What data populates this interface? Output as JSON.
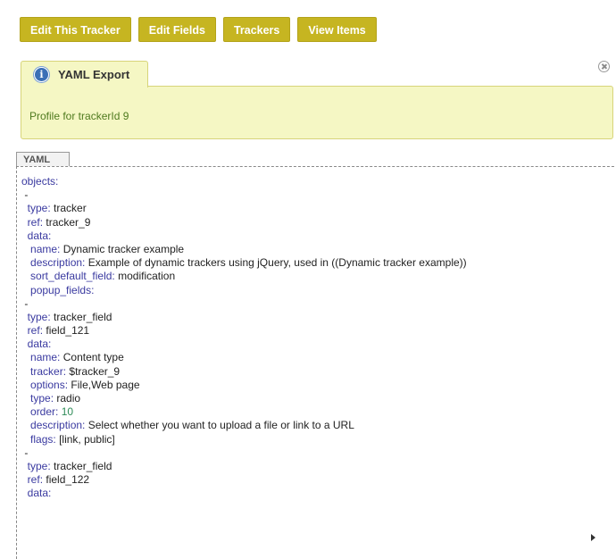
{
  "toolbar": {
    "buttons": [
      "Edit This Tracker",
      "Edit Fields",
      "Trackers",
      "View Items"
    ]
  },
  "panel": {
    "tab_label": "YAML Export",
    "message": "Profile for trackerId 9"
  },
  "yaml_tab_label": "YAML",
  "yaml": {
    "lines": [
      {
        "indent": "",
        "key": "objects",
        "value": ""
      },
      {
        "indent": " ",
        "key": "",
        "value": "-"
      },
      {
        "indent": "  ",
        "key": "type",
        "value": "tracker"
      },
      {
        "indent": "  ",
        "key": "ref",
        "value": "tracker_9"
      },
      {
        "indent": "  ",
        "key": "data",
        "value": ""
      },
      {
        "indent": "   ",
        "key": "name",
        "value": "Dynamic tracker example"
      },
      {
        "indent": "   ",
        "key": "description",
        "value": "Example of dynamic trackers using jQuery, used in ((Dynamic tracker example))"
      },
      {
        "indent": "   ",
        "key": "sort_default_field",
        "value": "modification"
      },
      {
        "indent": "   ",
        "key": "popup_fields",
        "value": ""
      },
      {
        "indent": " ",
        "key": "",
        "value": "-"
      },
      {
        "indent": "  ",
        "key": "type",
        "value": "tracker_field"
      },
      {
        "indent": "  ",
        "key": "ref",
        "value": "field_121"
      },
      {
        "indent": "  ",
        "key": "data",
        "value": ""
      },
      {
        "indent": "   ",
        "key": "name",
        "value": "Content type"
      },
      {
        "indent": "   ",
        "key": "tracker",
        "value": "$tracker_9"
      },
      {
        "indent": "   ",
        "key": "options",
        "value": "File,Web page"
      },
      {
        "indent": "   ",
        "key": "type",
        "value": "radio"
      },
      {
        "indent": "   ",
        "key": "order",
        "value": "10",
        "numeric": true
      },
      {
        "indent": "   ",
        "key": "description",
        "value": "Select whether you want to upload a file or link to a URL"
      },
      {
        "indent": "   ",
        "key": "flags",
        "value": "[link, public]"
      },
      {
        "indent": " ",
        "key": "",
        "value": "-"
      },
      {
        "indent": "  ",
        "key": "type",
        "value": "tracker_field"
      },
      {
        "indent": "  ",
        "key": "ref",
        "value": "field_122"
      },
      {
        "indent": "  ",
        "key": "data",
        "value": ""
      }
    ]
  }
}
